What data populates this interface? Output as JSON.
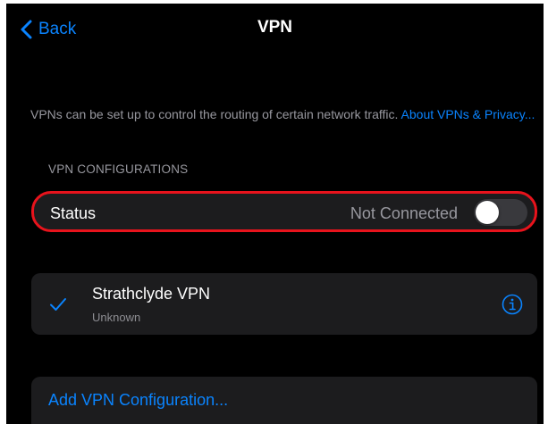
{
  "nav": {
    "back_label": "Back",
    "title": "VPN"
  },
  "description": {
    "text": "VPNs can be set up to control the routing of certain network traffic.",
    "link": "About VPNs & Privacy..."
  },
  "section": {
    "header": "VPN CONFIGURATIONS"
  },
  "status_row": {
    "label": "Status",
    "value": "Not Connected",
    "toggle_on": false
  },
  "vpn": {
    "name": "Strathclyde VPN",
    "status": "Unknown",
    "selected": true
  },
  "add_configuration": {
    "label": "Add VPN Configuration..."
  },
  "colors": {
    "accent": "#0a84ff",
    "highlight": "#e8131c",
    "background": "#000000",
    "card": "#1c1c1e"
  },
  "icons": {
    "back": "chevron-left-icon",
    "check": "checkmark-icon",
    "info": "info-circle-icon"
  }
}
